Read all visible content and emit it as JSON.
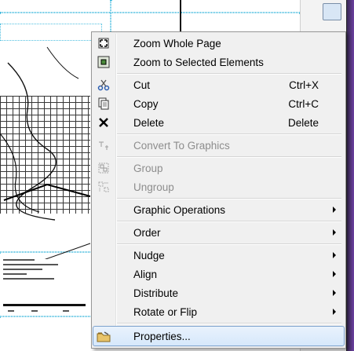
{
  "menu": {
    "items": [
      {
        "label": "Zoom Whole Page",
        "shortcut": "",
        "icon": "zoom-whole-page-icon",
        "disabled": false,
        "submenu": false
      },
      {
        "label": "Zoom to Selected Elements",
        "shortcut": "",
        "icon": "zoom-selected-icon",
        "disabled": false,
        "submenu": false
      },
      {
        "label": "Cut",
        "shortcut": "Ctrl+X",
        "icon": "scissors-icon",
        "disabled": false,
        "submenu": false
      },
      {
        "label": "Copy",
        "shortcut": "Ctrl+C",
        "icon": "copy-icon",
        "disabled": false,
        "submenu": false
      },
      {
        "label": "Delete",
        "shortcut": "Delete",
        "icon": "delete-x-icon",
        "disabled": false,
        "submenu": false
      },
      {
        "label": "Convert To Graphics",
        "shortcut": "",
        "icon": "convert-graphics-icon",
        "disabled": true,
        "submenu": false
      },
      {
        "label": "Group",
        "shortcut": "",
        "icon": "group-icon",
        "disabled": true,
        "submenu": false
      },
      {
        "label": "Ungroup",
        "shortcut": "",
        "icon": "ungroup-icon",
        "disabled": true,
        "submenu": false
      },
      {
        "label": "Graphic Operations",
        "shortcut": "",
        "icon": "",
        "disabled": false,
        "submenu": true
      },
      {
        "label": "Order",
        "shortcut": "",
        "icon": "",
        "disabled": false,
        "submenu": true
      },
      {
        "label": "Nudge",
        "shortcut": "",
        "icon": "",
        "disabled": false,
        "submenu": true
      },
      {
        "label": "Align",
        "shortcut": "",
        "icon": "",
        "disabled": false,
        "submenu": true
      },
      {
        "label": "Distribute",
        "shortcut": "",
        "icon": "",
        "disabled": false,
        "submenu": true
      },
      {
        "label": "Rotate or Flip",
        "shortcut": "",
        "icon": "",
        "disabled": false,
        "submenu": true
      },
      {
        "label": "Properties...",
        "shortcut": "",
        "icon": "properties-icon",
        "disabled": false,
        "submenu": false,
        "highlighted": true
      }
    ]
  },
  "colors": {
    "highlight_border": "#7da2ce",
    "menu_bg": "#f0f0f0",
    "disabled_text": "#8d8d8d"
  }
}
